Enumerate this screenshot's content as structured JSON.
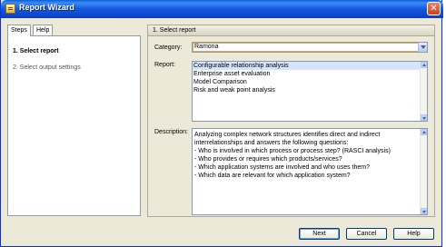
{
  "window": {
    "title": "Report Wizard",
    "close_glyph": "✕"
  },
  "left_panel": {
    "tabs": [
      {
        "label": "Steps"
      },
      {
        "label": "Help"
      }
    ],
    "steps": [
      {
        "label": "1. Select report"
      },
      {
        "label": "2. Select output settings"
      }
    ]
  },
  "right_panel": {
    "section_title": "1. Select report",
    "category": {
      "label": "Category:",
      "value": "Ramona"
    },
    "report": {
      "label": "Report:",
      "items": [
        "Configurable relationship analysis",
        "Enterprise asset evaluation",
        "Model Comparison",
        "Risk and weak point analysis"
      ],
      "selected_index": 0
    },
    "description": {
      "label": "Description:",
      "lines": [
        "Analyzing complex network structures identifies direct and indirect",
        "interrelationships and answers the following questions:",
        "- Who is involved in which process or process step? (RASCI analysis)",
        "- Who provides or requires which products/services?",
        "- Which application systems are involved and who uses them?",
        "- Which data are relevant for which application system?"
      ]
    }
  },
  "buttons": {
    "next": "Next",
    "cancel": "Cancel",
    "help": "Help"
  },
  "colors": {
    "title_bar": "#1457e0",
    "window_bg": "#ece9d8",
    "selection": "#d6e4fb",
    "focus_border": "#f0a63a"
  },
  "icons": [
    "wizard-icon",
    "close-icon",
    "dropdown-arrow-icon",
    "scroll-up-icon",
    "scroll-down-icon"
  ]
}
